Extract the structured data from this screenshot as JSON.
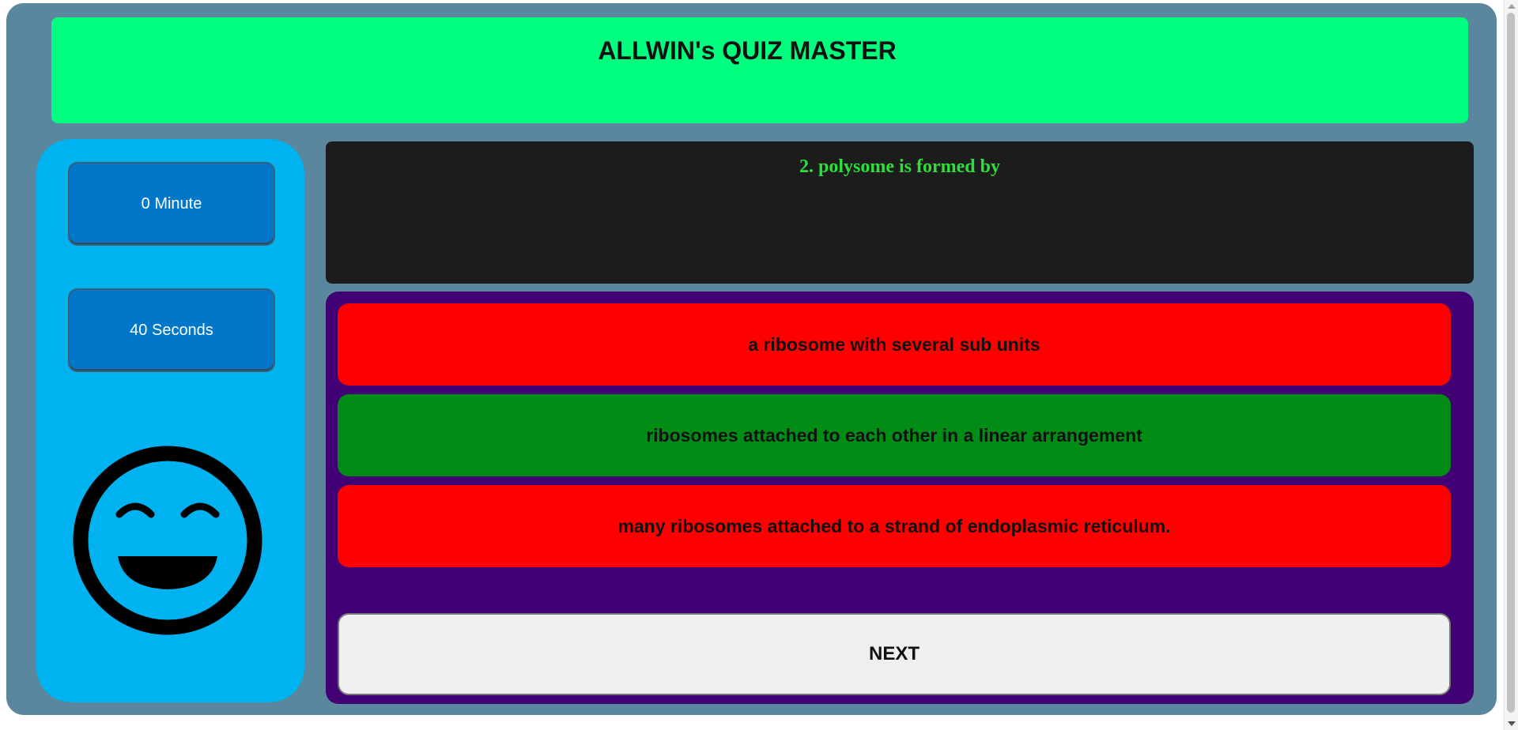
{
  "app": {
    "title": "ALLWIN's QUIZ MASTER"
  },
  "timer": {
    "minutes_label": "0 Minute",
    "seconds_label": "40 Seconds"
  },
  "question": {
    "text": "2. polysome is formed by"
  },
  "options": [
    {
      "text": "a ribosome with several sub units",
      "state": "wrong"
    },
    {
      "text": "ribosomes attached to each other in a linear arrangement",
      "state": "correct"
    },
    {
      "text": "many ribosomes attached to a strand of endoplasmic reticulum.",
      "state": "wrong"
    }
  ],
  "controls": {
    "next_label": "NEXT"
  },
  "status_icon": "grinning-face-icon",
  "colors": {
    "frame": "#5a869e",
    "header": "#00ff7f",
    "sidebar": "#00b2ef",
    "timer_box": "#0077c8",
    "question_bg": "#1c1c1c",
    "question_text": "#2ede3c",
    "answers_bg": "#420075",
    "wrong": "#ff0000",
    "correct": "#008c15",
    "next_bg": "#efefef"
  }
}
